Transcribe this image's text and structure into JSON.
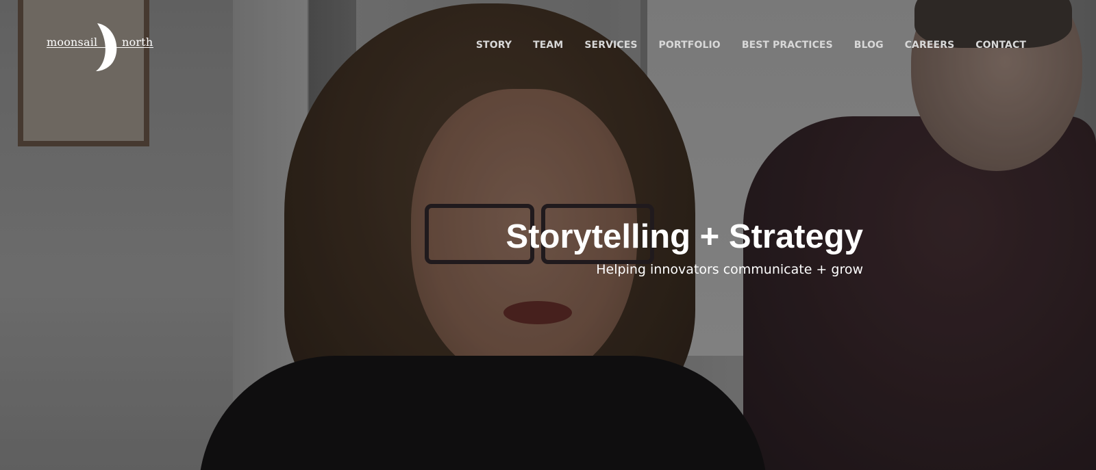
{
  "logo": {
    "left_text": "moonsail",
    "right_text": "north"
  },
  "nav": {
    "items": [
      {
        "label": "STORY"
      },
      {
        "label": "TEAM"
      },
      {
        "label": "SERVICES"
      },
      {
        "label": "PORTFOLIO"
      },
      {
        "label": "BEST PRACTICES"
      },
      {
        "label": "BLOG"
      },
      {
        "label": "CAREERS"
      },
      {
        "label": "CONTACT"
      }
    ]
  },
  "hero": {
    "title": "Storytelling + Strategy",
    "subtitle": "Helping innovators communicate + grow"
  },
  "colors": {
    "text": "#ffffff",
    "nav_text": "#d8d8d8"
  }
}
